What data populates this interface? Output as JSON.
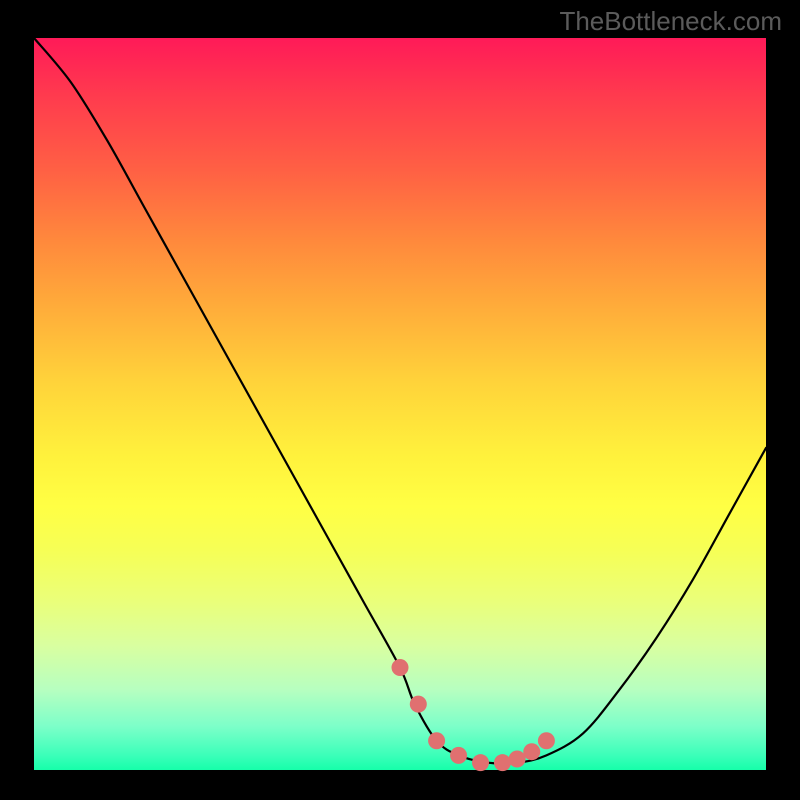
{
  "watermark": "TheBottleneck.com",
  "chart_data": {
    "type": "line",
    "title": "",
    "xlabel": "",
    "ylabel": "",
    "xlim": [
      0,
      100
    ],
    "ylim": [
      0,
      100
    ],
    "grid": false,
    "series": [
      {
        "name": "curve",
        "color": "#000000",
        "x": [
          0,
          5,
          10,
          15,
          20,
          25,
          30,
          35,
          40,
          45,
          50,
          52,
          55,
          58,
          62,
          66,
          70,
          75,
          80,
          85,
          90,
          95,
          100
        ],
        "values": [
          100,
          94,
          86,
          77,
          68,
          59,
          50,
          41,
          32,
          23,
          14,
          9,
          4,
          2,
          1,
          1,
          2,
          5,
          11,
          18,
          26,
          35,
          44
        ]
      }
    ],
    "highlight": {
      "name": "bottom-markers",
      "color": "#e07070",
      "x": [
        50,
        52.5,
        55,
        58,
        61,
        64,
        66,
        68,
        70
      ],
      "values": [
        14,
        9,
        4,
        2,
        1,
        1,
        1.5,
        2.5,
        4
      ]
    },
    "gradient_stops": [
      {
        "pct": 0,
        "color": "#ff1a58"
      },
      {
        "pct": 18,
        "color": "#ff6044"
      },
      {
        "pct": 37,
        "color": "#ffad3a"
      },
      {
        "pct": 57,
        "color": "#fff13c"
      },
      {
        "pct": 77,
        "color": "#eaff7a"
      },
      {
        "pct": 94,
        "color": "#7dffc9"
      },
      {
        "pct": 100,
        "color": "#16ffaa"
      }
    ]
  }
}
